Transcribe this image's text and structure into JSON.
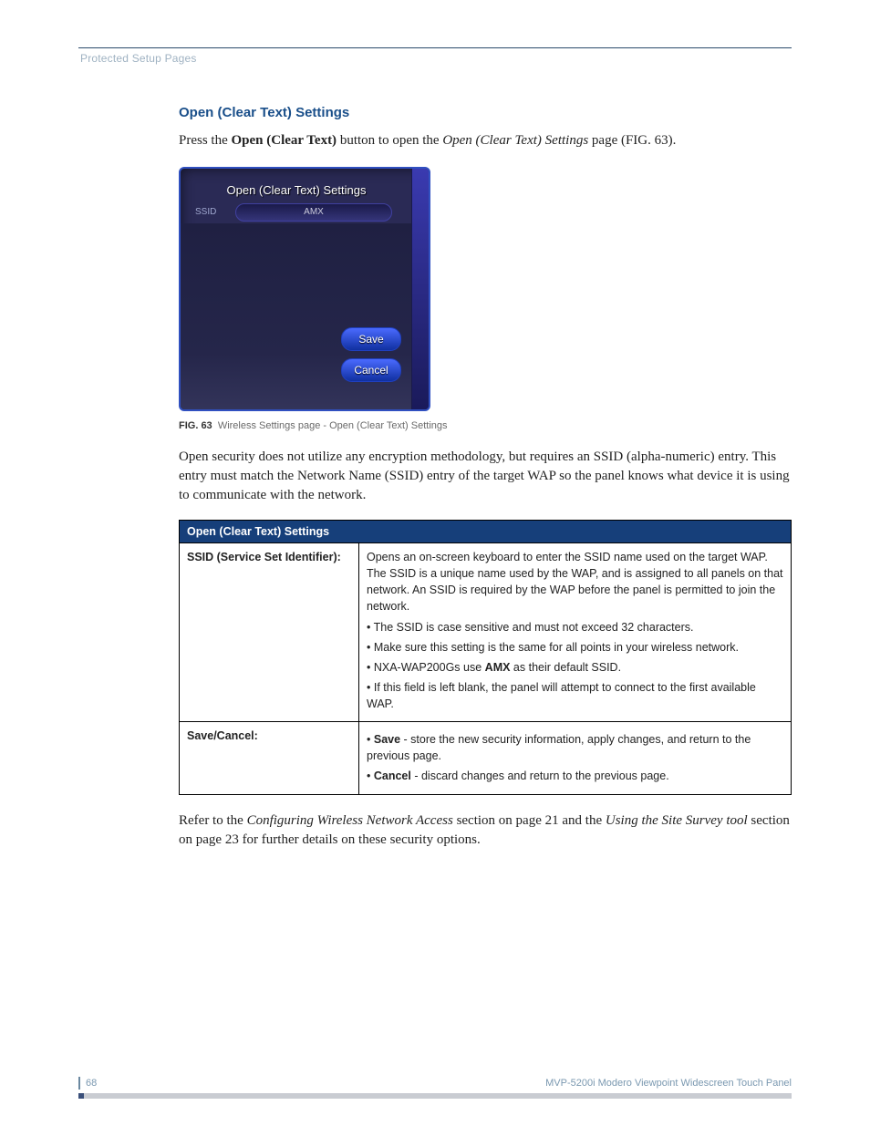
{
  "header": {
    "breadcrumb": "Protected Setup Pages"
  },
  "title": "Open (Clear Text) Settings",
  "intro": {
    "prefix": "Press the ",
    "bold": "Open (Clear Text)",
    "mid": " button to open the ",
    "italic": "Open (Clear Text) Settings",
    "suffix": " page (FIG. 63)."
  },
  "device": {
    "modal_title": "Open (Clear Text) Settings",
    "ssid_label": "SSID",
    "ssid_value": "AMX",
    "save": "Save",
    "cancel": "Cancel"
  },
  "caption": {
    "label": "FIG. 63",
    "text": "Wireless Settings page - Open (Clear Text) Settings"
  },
  "paragraph2": "Open security does not utilize any encryption methodology, but requires an SSID (alpha-numeric) entry. This entry must match the Network Name (SSID) entry of the target WAP so the panel knows what device it is using to communicate with the network.",
  "table": {
    "header": "Open (Clear Text) Settings",
    "row1": {
      "label": "SSID (Service Set Identifier):",
      "desc": "Opens an on-screen keyboard to enter the SSID name used on the target WAP. The SSID is a unique name used by the WAP, and is assigned to all panels on that network. An SSID is required by the WAP before the panel is permitted to join the network.",
      "b1": "The SSID is case sensitive and must not exceed 32 characters.",
      "b2": "Make sure this setting is the same for all points in your wireless network.",
      "b3a": "NXA-WAP200Gs use ",
      "b3b": "AMX",
      "b3c": " as their default SSID.",
      "b4": "If this field is left blank, the panel will attempt to connect to the first available WAP."
    },
    "row2": {
      "label": "Save/Cancel:",
      "s1a": "Save",
      "s1b": " - store the new security information, apply changes, and return to the previous page.",
      "s2a": "Cancel",
      "s2b": " - discard changes and return to the previous page."
    }
  },
  "closing": {
    "t1": "Refer to the ",
    "i1": "Configuring Wireless Network Access",
    "t2": " section on page 21 and the ",
    "i2": "Using the Site Survey tool",
    "t3": " section on page 23 for further details on these security options."
  },
  "footer": {
    "page": "68",
    "doc": "MVP-5200i Modero Viewpoint Widescreen Touch Panel"
  }
}
